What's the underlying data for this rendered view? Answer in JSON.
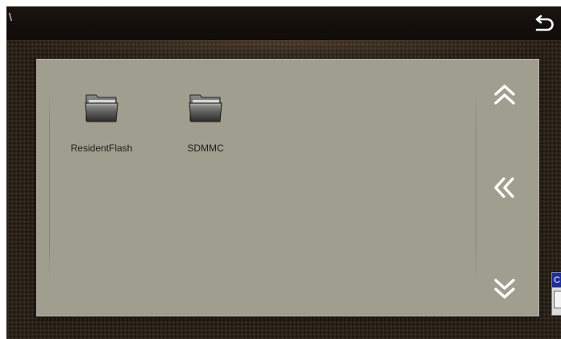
{
  "header": {
    "path": "\\",
    "back_icon": "return-arrow-icon"
  },
  "files": [
    {
      "label": "ResidentFlash",
      "icon": "folder-icon"
    },
    {
      "label": "SDMMC",
      "icon": "folder-icon"
    }
  ],
  "navigation": {
    "page_up_icon": "double-chevron-up-icon",
    "back_level_icon": "double-chevron-left-icon",
    "page_down_icon": "double-chevron-down-icon"
  },
  "side_widget": {
    "title_initial": "C"
  },
  "colors": {
    "panel": "#a09e8e",
    "background": "#2a2118",
    "topbar": "#0f0b08",
    "widget_title": "#1e2f9a"
  }
}
